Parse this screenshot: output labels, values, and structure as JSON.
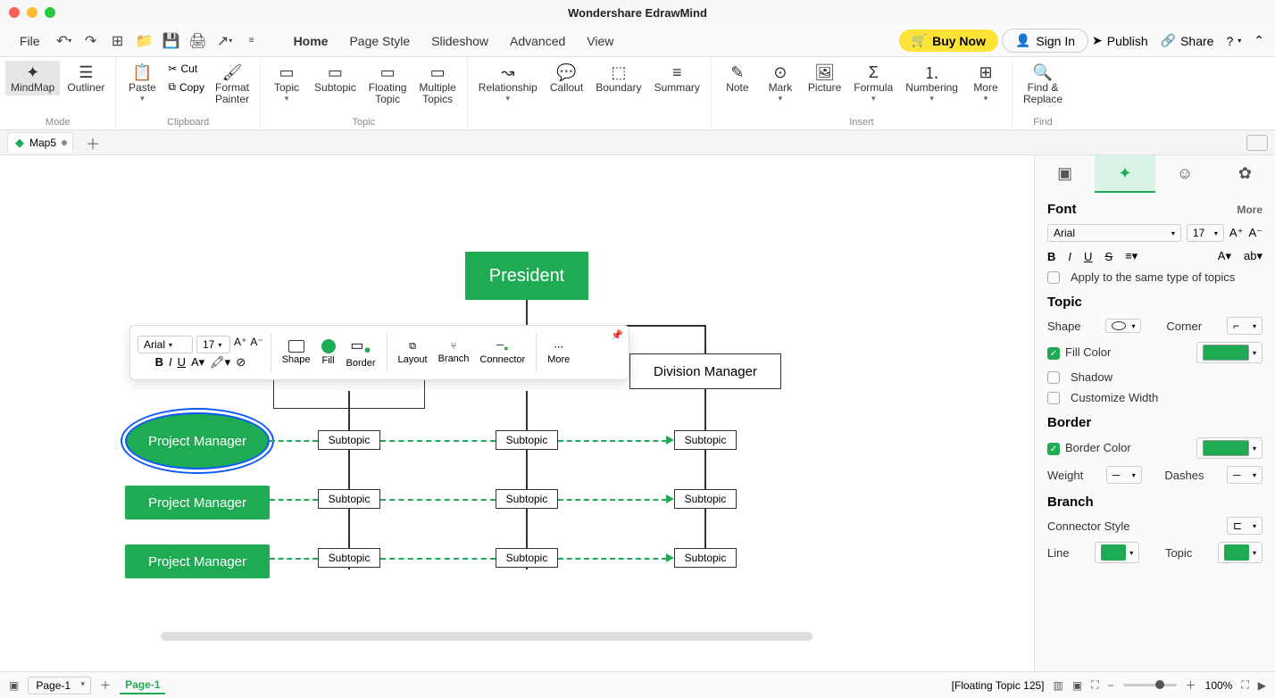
{
  "app_title": "Wondershare EdrawMind",
  "menubar": {
    "file": "File",
    "items": [
      "Home",
      "Page Style",
      "Slideshow",
      "Advanced",
      "View"
    ],
    "buy_now": "Buy Now",
    "sign_in": "Sign In",
    "publish": "Publish",
    "share": "Share"
  },
  "ribbon": {
    "mode": {
      "mindmap": "MindMap",
      "outliner": "Outliner",
      "label": "Mode"
    },
    "clipboard": {
      "paste": "Paste",
      "cut": "Cut",
      "copy": "Copy",
      "fmtpainter": "Format\nPainter",
      "label": "Clipboard"
    },
    "topic": {
      "topic": "Topic",
      "subtopic": "Subtopic",
      "floating": "Floating\nTopic",
      "multiple": "Multiple\nTopics",
      "label": "Topic"
    },
    "rel": {
      "relationship": "Relationship",
      "callout": "Callout",
      "boundary": "Boundary",
      "summary": "Summary"
    },
    "insert": {
      "note": "Note",
      "mark": "Mark",
      "picture": "Picture",
      "formula": "Formula",
      "numbering": "Numbering",
      "more": "More",
      "label": "Insert"
    },
    "find": {
      "findreplace": "Find &\nReplace",
      "label": "Find"
    }
  },
  "tabs": {
    "doc": "Map5"
  },
  "canvas": {
    "president": "President",
    "division_manager": "Division Manager",
    "pm": "Project Manager",
    "subtopic": "Subtopic"
  },
  "float_toolbar": {
    "font": "Arial",
    "size": "17",
    "shape": "Shape",
    "fill": "Fill",
    "border": "Border",
    "layout": "Layout",
    "branch": "Branch",
    "connector": "Connector",
    "more": "More"
  },
  "sidepanel": {
    "font": {
      "title": "Font",
      "more": "More",
      "family": "Arial",
      "size": "17",
      "apply_same": "Apply to the same type of topics"
    },
    "topic": {
      "title": "Topic",
      "shape": "Shape",
      "corner": "Corner",
      "fill_color": "Fill Color",
      "shadow": "Shadow",
      "customize_width": "Customize Width"
    },
    "border": {
      "title": "Border",
      "border_color": "Border Color",
      "weight": "Weight",
      "dashes": "Dashes"
    },
    "branch": {
      "title": "Branch",
      "connector_style": "Connector Style",
      "line": "Line",
      "topic": "Topic"
    }
  },
  "statusbar": {
    "page_selector": "Page-1",
    "page_tab": "Page-1",
    "selection_info": "[Floating Topic 125]",
    "zoom": "100%"
  }
}
